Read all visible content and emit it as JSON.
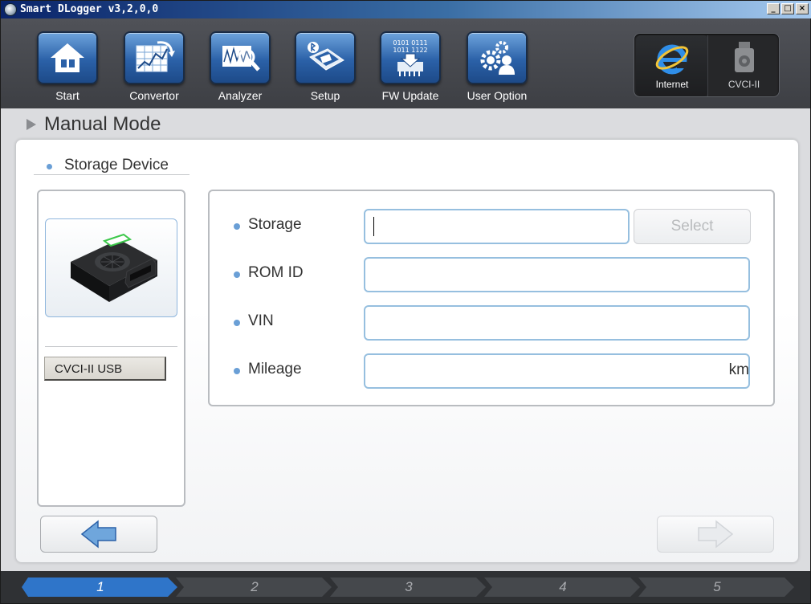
{
  "window": {
    "title": "Smart DLogger v3,2,0,0",
    "controls": [
      "_",
      "□",
      "×"
    ]
  },
  "toolbar": {
    "items": [
      {
        "label": "Start",
        "icon": "home-icon"
      },
      {
        "label": "Convertor",
        "icon": "convertor-icon"
      },
      {
        "label": "Analyzer",
        "icon": "analyzer-icon"
      },
      {
        "label": "Setup",
        "icon": "setup-icon"
      },
      {
        "label": "FW Update",
        "icon": "fw-update-icon",
        "icon_text": [
          "0101 0111",
          "1011 1122"
        ]
      },
      {
        "label": "User Option",
        "icon": "user-option-icon"
      }
    ],
    "connections": [
      {
        "label": "Internet",
        "icon": "internet-explorer-icon",
        "active": true
      },
      {
        "label": "CVCI-II",
        "icon": "cvci-device-icon",
        "active": false
      }
    ]
  },
  "mode": {
    "title": "Manual Mode"
  },
  "section": {
    "title": "Storage Device"
  },
  "device": {
    "image": "cvci-device-image",
    "tab_label": "CVCI-II USB"
  },
  "form": {
    "storage": {
      "label": "Storage",
      "value": "",
      "select_label": "Select"
    },
    "rom_id": {
      "label": "ROM ID",
      "value": ""
    },
    "vin": {
      "label": "VIN",
      "value": ""
    },
    "mileage": {
      "label": "Mileage",
      "value": "",
      "unit": "km"
    }
  },
  "navigation": {
    "prev": {
      "icon": "arrow-left-icon",
      "enabled": true
    },
    "next": {
      "icon": "arrow-right-icon",
      "enabled": false
    }
  },
  "steps": {
    "active_index": 0,
    "items": [
      "1",
      "2",
      "3",
      "4",
      "5"
    ]
  },
  "colors": {
    "accent": "#2b61a8",
    "field_border": "#96bfdf",
    "bullet": "#6a9fd6",
    "active_step": "#2f75c9"
  }
}
